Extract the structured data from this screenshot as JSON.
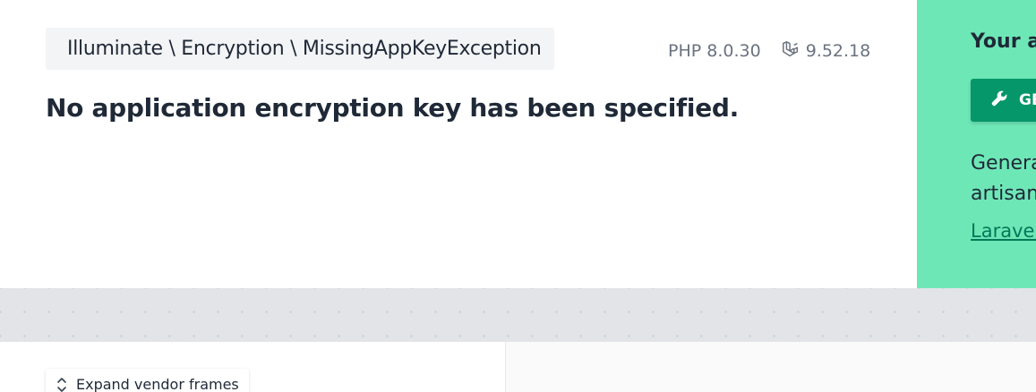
{
  "header": {
    "exception_class": "Illuminate \\ Encryption \\ MissingAppKeyException",
    "php_version": "PHP 8.0.30",
    "laravel_version": "9.52.18",
    "message": "No application encryption key has been specified."
  },
  "solution": {
    "title": "Your ap",
    "button_label": "GE",
    "description_line1": "Genera",
    "description_line2": "artisan",
    "link_text": "Laravel i"
  },
  "stack": {
    "expand_label": "Expand vendor frames"
  },
  "colors": {
    "solution_bg": "#6ee7b7",
    "solution_button": "#059669",
    "link": "#047857"
  },
  "icons": {
    "laravel": "laravel-icon",
    "wrench": "wrench-icon",
    "expand": "chevron-up-down-icon"
  }
}
